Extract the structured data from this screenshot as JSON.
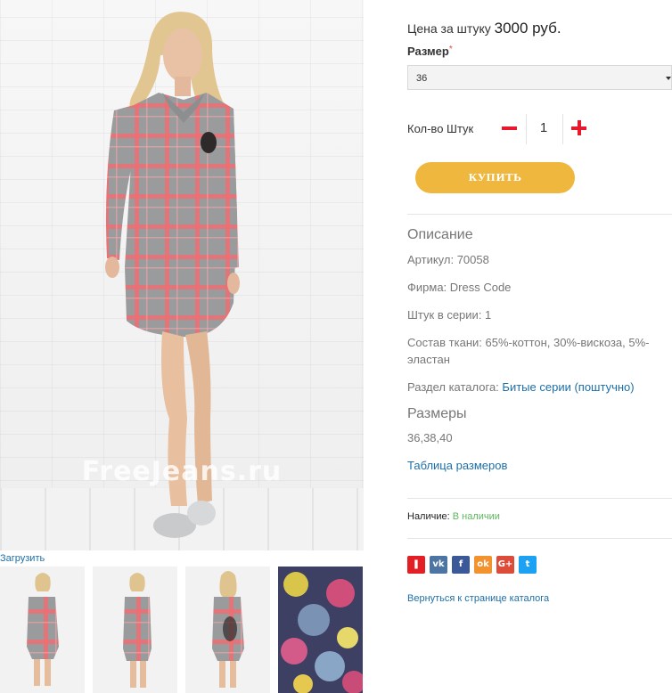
{
  "product": {
    "photo_alt": "FreeJeans.ru",
    "watermark": "FreeJeans.ru",
    "upload_link": "Загрузить",
    "thumbnails": [
      "thumb-front",
      "thumb-side",
      "thumb-back",
      "thumb-fabric"
    ]
  },
  "purchase": {
    "price_prefix": "Цена за штуку",
    "price_value": "3000 руб.",
    "size_label": "Размер",
    "required_mark": "*",
    "size_selected": "36",
    "qty_label": "Кол-во Штук",
    "qty_value": "1",
    "buy_label": "КУПИТЬ"
  },
  "description": {
    "title": "Описание",
    "article": "Артикул: 70058",
    "brand": "Фирма: Dress Code",
    "pieces": "Штук в серии: 1",
    "composition": "Состав ткани: 65%-коттон, 30%-вискоза, 5%-эластан",
    "catalog_prefix": "Раздел каталога:",
    "catalog_link": "Битые серии (поштучно)"
  },
  "sizes": {
    "title": "Размеры",
    "values": "36,38,40",
    "table_link": "Таблица размеров"
  },
  "availability": {
    "label": "Наличие:",
    "status": "В наличии"
  },
  "share": [
    {
      "icon": "bookmark-icon",
      "color": "#e31f25",
      "glyph": "❚"
    },
    {
      "icon": "vk-icon",
      "color": "#4c75a3",
      "glyph": "vk"
    },
    {
      "icon": "facebook-icon",
      "color": "#3b5998",
      "glyph": "f"
    },
    {
      "icon": "odnoklassniki-icon",
      "color": "#f2932f",
      "glyph": "ok"
    },
    {
      "icon": "google-plus-icon",
      "color": "#dd4b39",
      "glyph": "G+"
    },
    {
      "icon": "twitter-icon",
      "color": "#1da1f2",
      "glyph": "t"
    }
  ],
  "back_link": "Вернуться к странице каталога",
  "colors": {
    "accent_button": "#efb73e",
    "link": "#1e6fa8",
    "qty_controls": "#e8192c",
    "in_stock": "#5cb85c"
  }
}
